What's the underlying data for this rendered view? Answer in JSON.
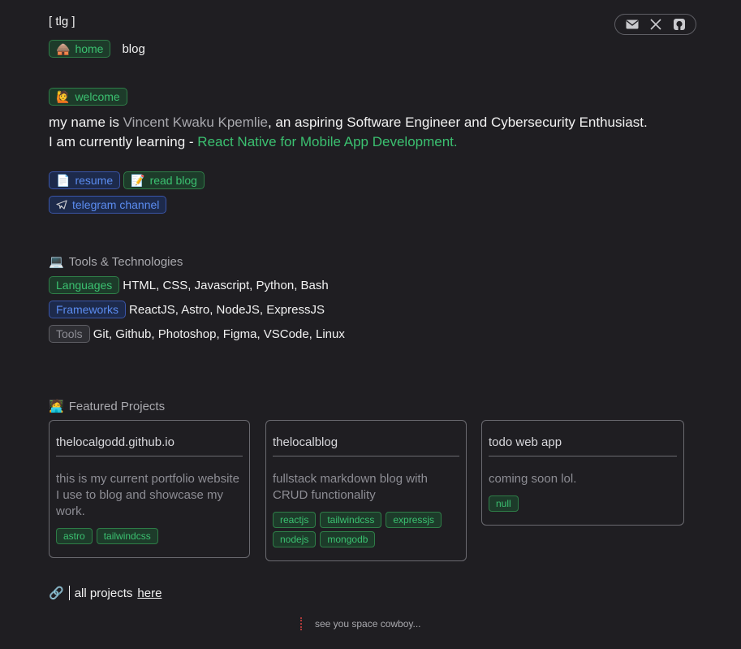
{
  "brand": "[ tlg ]",
  "social": {
    "items": [
      {
        "icon": "mail-icon"
      },
      {
        "icon": "x-icon"
      },
      {
        "icon": "github-icon"
      }
    ]
  },
  "nav": {
    "home_emoji": "🛖",
    "home_label": "home",
    "blog_label": "blog"
  },
  "welcome": {
    "emoji": "🙋",
    "label": "welcome"
  },
  "intro": {
    "prefix": "my name is ",
    "name": "Vincent Kwaku Kpemlie",
    "suffix": ", an aspiring Software Engineer and Cybersecurity Enthusiast.",
    "learning_prefix": "I am currently learning - ",
    "learning": "React Native for Mobile App Development."
  },
  "links": {
    "resume_emoji": "📄",
    "resume": "resume",
    "blog_emoji": "📝",
    "blog": "read blog",
    "telegram": "telegram channel"
  },
  "tools": {
    "emoji": "💻",
    "title": "Tools & Technologies",
    "rows": [
      {
        "label": "Languages",
        "items": "HTML, CSS, Javascript, Python, Bash"
      },
      {
        "label": "Frameworks",
        "items": "ReactJS, Astro, NodeJS, ExpressJS"
      },
      {
        "label": "Tools",
        "items": "Git, Github, Photoshop, Figma, VSCode, Linux"
      }
    ]
  },
  "projects": {
    "emoji": "🧑‍💻",
    "title": "Featured Projects",
    "cards": [
      {
        "title": "thelocalgodd.github.io",
        "desc": "this is my current portfolio website I use to blog and showcase my work.",
        "tags": [
          "astro",
          "tailwindcss"
        ]
      },
      {
        "title": "thelocalblog",
        "desc": "fullstack markdown blog with CRUD functionality",
        "tags": [
          "reactjs",
          "tailwindcss",
          "expressjs",
          "nodejs",
          "mongodb"
        ]
      },
      {
        "title": "todo web app",
        "desc": "coming soon lol.",
        "tags": [
          "null"
        ]
      }
    ]
  },
  "all_projects": {
    "emoji": "🔗",
    "text": "all projects here",
    "link": "here"
  },
  "footer": "see you space cowboy...",
  "colors": {
    "background": "#1f1e22",
    "accent_green": "#3bc070",
    "accent_blue": "#5b8cf0",
    "muted": "#a9a9ae"
  }
}
